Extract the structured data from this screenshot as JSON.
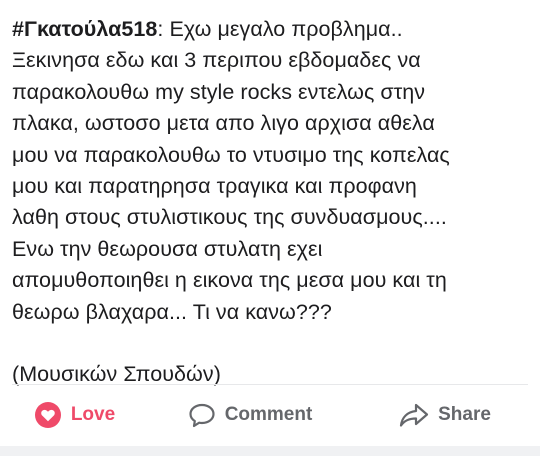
{
  "post": {
    "author": "#Γκατούλα518",
    "text_lines": [
      ": Εχω μεγαλο προβλημα..",
      "Ξεκινησα εδω και 3 περιπου εβδομαδες να",
      "παρακολουθω my style rocks εντελως στην",
      "πλακα, ωστοσο μετα απο λιγο αρχισα αθελα",
      "μου να παρακολουθω το ντυσιμο της κοπελας",
      "μου και παρατηρησα τραγικα και προφανη",
      "λαθη στους στυλιστικους της συνδυασμους....",
      "Ενω την θεωρουσα στυλατη εχει",
      "απομυθοποιηθει η εικονα της μεσα μου και τη",
      "θεωρω βλαχαρα... Τι να κανω???"
    ],
    "signature": "(Μουσικών Σπουδών)"
  },
  "actions": {
    "love": {
      "label": "Love",
      "icon": "heart-icon",
      "color": "#ef4a69"
    },
    "comment": {
      "label": "Comment",
      "icon": "comment-icon",
      "color": "#65676b"
    },
    "share": {
      "label": "Share",
      "icon": "share-arrow-icon",
      "color": "#65676b"
    }
  }
}
